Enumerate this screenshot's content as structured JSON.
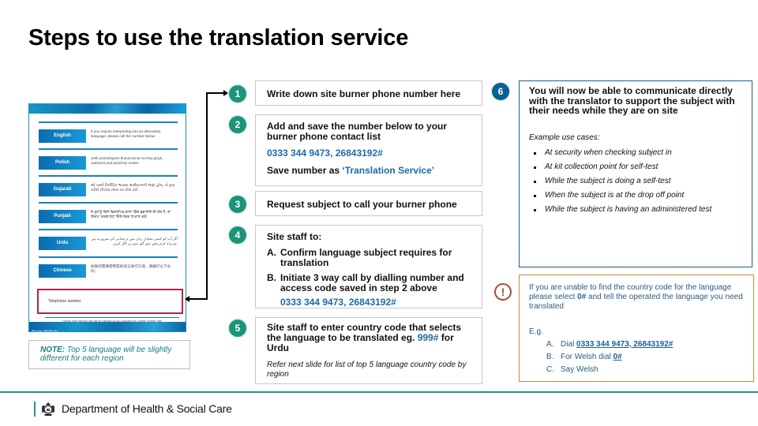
{
  "title": "Steps to use the translation service",
  "poster": {
    "rows": [
      {
        "language": "English",
        "text": "If you require interpreting into an alternative language, please call the number below:"
      },
      {
        "language": "Polish",
        "text": "Jeśli potrzebujesz tłumaczenia na inny język, zadzwoń pod poniższy numer:"
      },
      {
        "language": "Gujarati",
        "text": "જો તમને વૈકલ્પિક ભાષામાં અર્થઘટનની જરૂર હોય, તો કૃપા કરીને નીચેના નંબર પર કૉલ કરો:"
      },
      {
        "language": "Punjabi",
        "text": "ਜੇ ਤੁਹਾਨੂੰ ਕਿਸੇ ਵਿਕਲਪਿਕ ਭਾਸ਼ਾ ਵਿੱਚ ਦੁਭਾਸ਼ੀਏ ਦੀ ਲੋੜ ਹੈ, ਤਾਂ ਕਿਰਪਾ ਕਰਕੇ ਹੇਠਾਂ ਦਿੱਤੇ ਨੰਬਰ 'ਤੇ ਕਾਲ ਕਰੋ:"
      },
      {
        "language": "Urdu",
        "text": "اگر آپ کو کسی متبادل زبان میں ترجمانی کی ضرورت ہے تو براہ کرم نیچے دیئے گئے نمبر پر کال کریں:"
      },
      {
        "language": "Chinese",
        "text": "如果您需要使用其他语言进行口译，请拨打以下号码："
      }
    ],
    "telephone_label": "Telephone number",
    "footer_note": "Please note that this call will be charged at your standard UK mobile number rate",
    "region": "Region: Midlands"
  },
  "note": {
    "label": "NOTE:",
    "text": "Top 5 language will be slightly different for each region"
  },
  "steps": [
    {
      "number": "1",
      "text": "Write down site burner phone number here"
    },
    {
      "number": "2",
      "text": "Add and save the number below to your burner phone contact list",
      "phone": "0333 344 9473, 26843192#",
      "save_prefix": "Save number as ",
      "save_name": "‘Translation Service’"
    },
    {
      "number": "3",
      "text": "Request subject to call your burner phone"
    },
    {
      "number": "4",
      "text": "Site staff to:",
      "items": [
        {
          "letter": "A.",
          "text": "Confirm language subject requires for translation"
        },
        {
          "letter": "B.",
          "text": "Initiate 3 way call by dialling number and access code saved in step 2 above"
        }
      ],
      "phone": "0333 344 9473, 26843192#"
    },
    {
      "number": "5",
      "text_before": "Site staff to enter country code that selects the language to be translated eg. ",
      "code": "999#",
      "text_after": " for Urdu",
      "note": "Refer next slide for list of top 5 language country code by region"
    },
    {
      "number": "6",
      "text": "You will now be able to communicate directly with the translator to support the subject with their needs while they are on site",
      "examples_label": "Example use cases:",
      "examples": [
        "At security when checking subject in",
        "At kit collection point for self-test",
        "While the subject is doing a self-test",
        "When the subject is at the drop off point",
        "While the subject is having an administered test"
      ]
    }
  ],
  "warning": {
    "icon": "!",
    "text_before": "If you are unable to find the country code for the language please select ",
    "code": "0#",
    "text_after": " and tell the operated the language you need translated",
    "eg_label": "E.g.",
    "items": [
      {
        "letter": "A.",
        "text": "Dial ",
        "link": "0333 344 9473, 26843192#"
      },
      {
        "letter": "B.",
        "text": "For Welsh dial ",
        "link": "0#"
      },
      {
        "letter": "C.",
        "text": "Say Welsh",
        "link": ""
      }
    ]
  },
  "footer": {
    "organisation": "Department of Health & Social Care"
  },
  "colors": {
    "step_green": "#1d9479",
    "step_blue": "#0b5f94",
    "link_blue": "#1f6aa5",
    "warning_brown": "#a0522d",
    "highlight_red": "#b0254b",
    "footer_teal": "#2b8f86"
  }
}
